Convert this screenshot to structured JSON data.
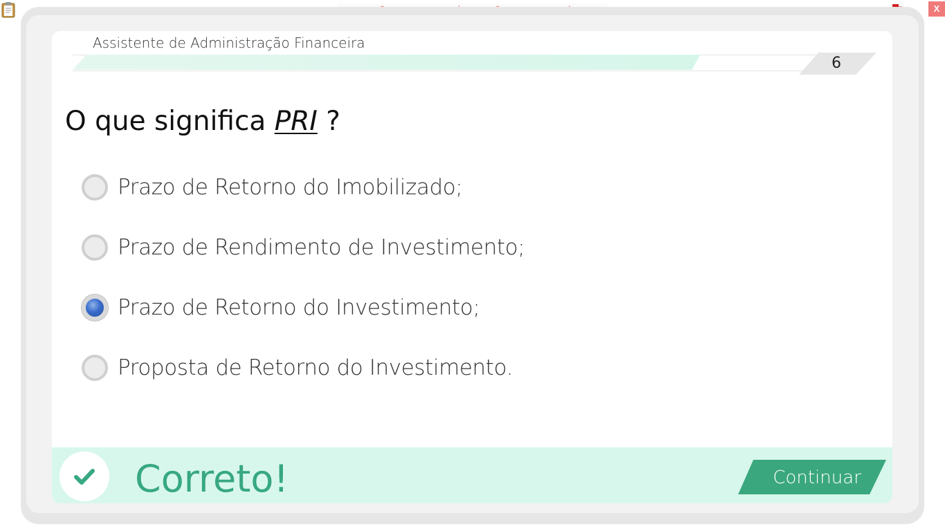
{
  "top_bar": {
    "banner": "VERSÃO PARA FUNCIONÁRIOS - NÃO COMERCIALIZÁVEL",
    "close_label": "X",
    "clipboard_icon": "clipboard-icon",
    "tray_icon": "notification-tray-icon"
  },
  "header": {
    "course_title": "Assistente de Administração Financeira",
    "progress": 0.84,
    "page_number": "6"
  },
  "question": {
    "prefix": "O que significa",
    "term": "PRI",
    "suffix": "?"
  },
  "options": [
    {
      "label": "Prazo de Retorno do Imobilizado;",
      "selected": false
    },
    {
      "label": "Prazo de Rendimento de Investimento;",
      "selected": false
    },
    {
      "label": "Prazo de Retorno do Investimento;",
      "selected": true
    },
    {
      "label": "Proposta de Retorno do Investimento.",
      "selected": false
    }
  ],
  "feedback": {
    "status": "Correto!",
    "icon": "checkmark-icon",
    "continue_label": "Continuar"
  },
  "colors": {
    "accent_green": "#37a882",
    "feedback_bg": "#d8f7ec",
    "progress_fill": "#d6f6ea",
    "radio_selected": "#3a6ccc",
    "banner_text": "#f08080",
    "close_bg": "#f07a7a"
  }
}
